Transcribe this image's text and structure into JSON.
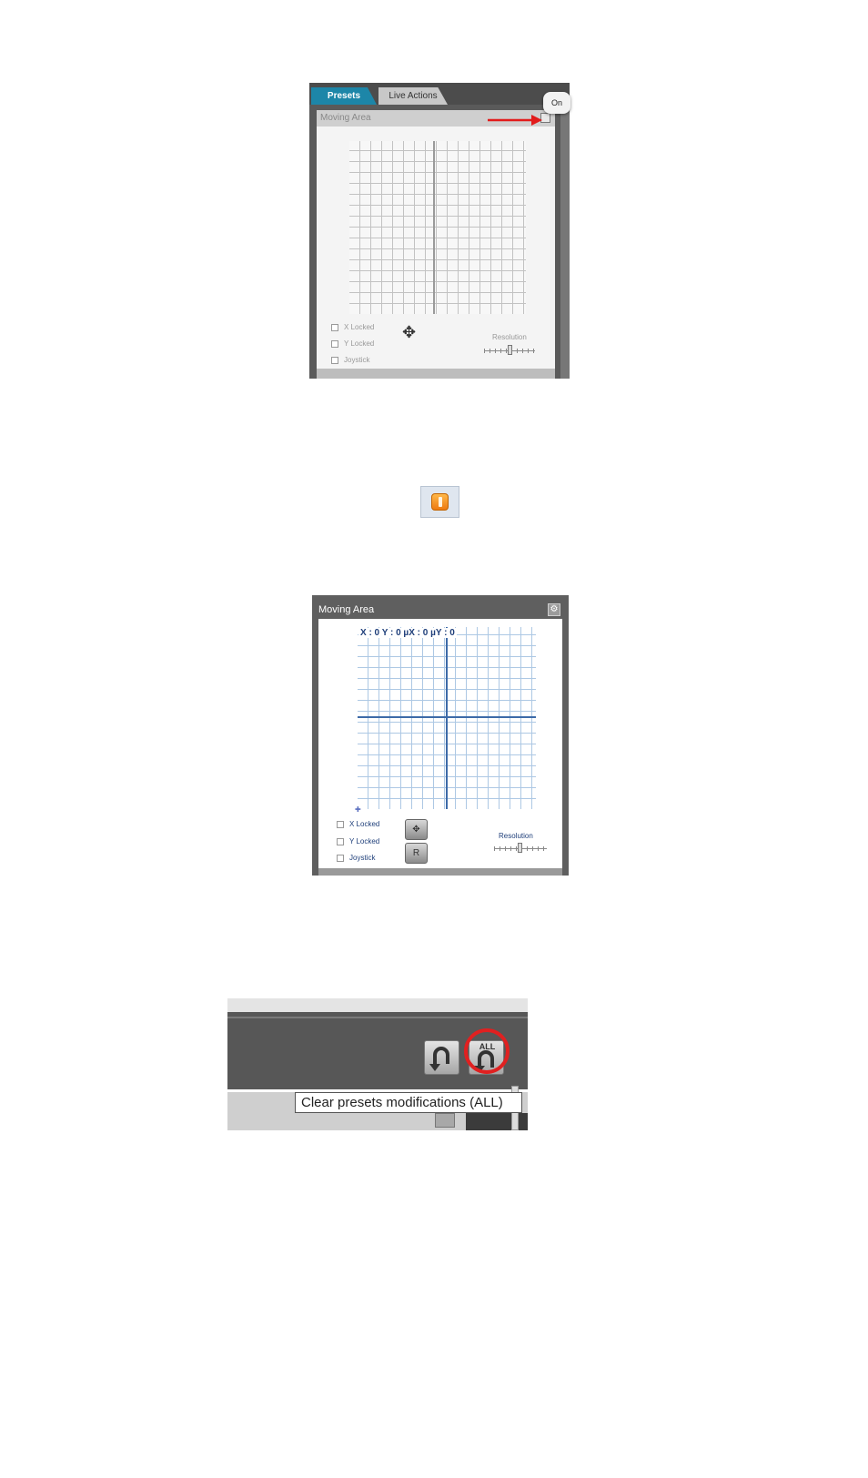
{
  "screenshot1": {
    "tabs": [
      {
        "label": "Presets",
        "active": true
      },
      {
        "label": "Live Actions",
        "active": false
      }
    ],
    "panel_title": "Moving Area",
    "tooltip_on": "On",
    "checkboxes": [
      "X Locked",
      "Y Locked",
      "Joystick"
    ],
    "resolution_label": "Resolution",
    "icons": {
      "move": "four-way-arrow-icon",
      "toggle": "power-toggle-icon",
      "annotation": "red-arrow"
    }
  },
  "orange_button": {
    "icon": "power-on-icon",
    "color": "#f08a1c"
  },
  "screenshot2": {
    "panel_title": "Moving Area",
    "coordinates": "X : 0 Y : 0 µX : 0 µY : 0",
    "checkboxes": [
      "X Locked",
      "Y Locked",
      "Joystick"
    ],
    "reset_label": "R",
    "resolution_label": "Resolution",
    "icons": {
      "move": "four-way-arrow-icon",
      "settings": "settings-icon"
    },
    "accent_color": "#1f3f7a"
  },
  "screenshot3": {
    "all_label": "ALL",
    "tooltip": "Clear presets modifications (ALL)",
    "icons": {
      "undo": "undo-icon",
      "undo_all": "undo-all-icon"
    },
    "highlight_color": "#e02020"
  }
}
